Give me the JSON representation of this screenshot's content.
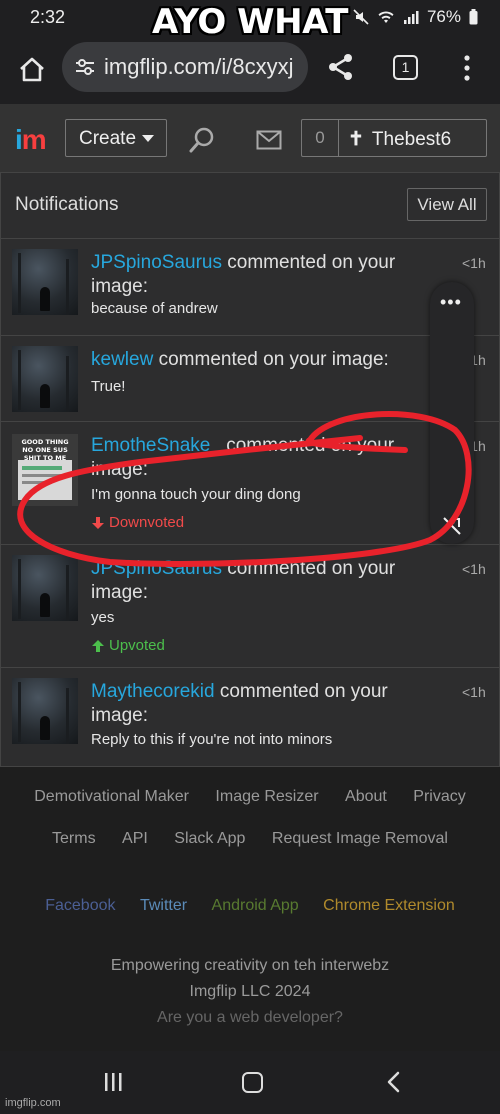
{
  "overlay_caption": "AYO WHAT",
  "status_bar": {
    "time": "2:32",
    "battery": "76%"
  },
  "browser": {
    "url": "imgflip.com/i/8cxyxj",
    "tab_count": "1"
  },
  "site_header": {
    "logo_i": "i",
    "logo_m": "m",
    "create_label": "Create",
    "notification_count": "0",
    "username": "Thebest6"
  },
  "notifications": {
    "title": "Notifications",
    "view_all": "View All",
    "items": [
      {
        "user": "JPSpinoSaurus",
        "action": " commented on your image:",
        "comment": "because of andrew",
        "time": "<1h"
      },
      {
        "user": "kewlew",
        "action": " commented on your image:",
        "comment": "True!",
        "time": "<1h"
      },
      {
        "user": "EmotheSnake_",
        "action": " commented on your image:",
        "comment": "I'm gonna touch your ding dong",
        "time": "<1h",
        "vote": "Downvoted",
        "thumb_caption": "GOOD THING NO ONE SUS SHIT TO ME"
      },
      {
        "user": "JPSpinoSaurus",
        "action": " commented on your image:",
        "comment": "yes",
        "time": "<1h",
        "vote": "Upvoted"
      },
      {
        "user": "Maythecorekid",
        "action": " commented on your image:",
        "comment": "Reply to this if you're not into minors",
        "time": "<1h"
      }
    ]
  },
  "footer": {
    "links_row1": [
      "Demotivational Maker",
      "Image Resizer",
      "About",
      "Privacy"
    ],
    "links_row2": [
      "Terms",
      "API",
      "Slack App",
      "Request Image Removal"
    ],
    "social": [
      "Facebook",
      "Twitter",
      "Android App",
      "Chrome Extension"
    ],
    "tagline": "Empowering creativity on teh interwebz",
    "copyright": "Imgflip LLC 2024",
    "developer": "Are you a web developer?"
  },
  "watermark": "imgflip.com",
  "colors": {
    "link_blue": "#27a7dd",
    "downvote_red": "#f04a4a",
    "upvote_green": "#4cbf4c",
    "annotation_red": "#e8222b"
  }
}
